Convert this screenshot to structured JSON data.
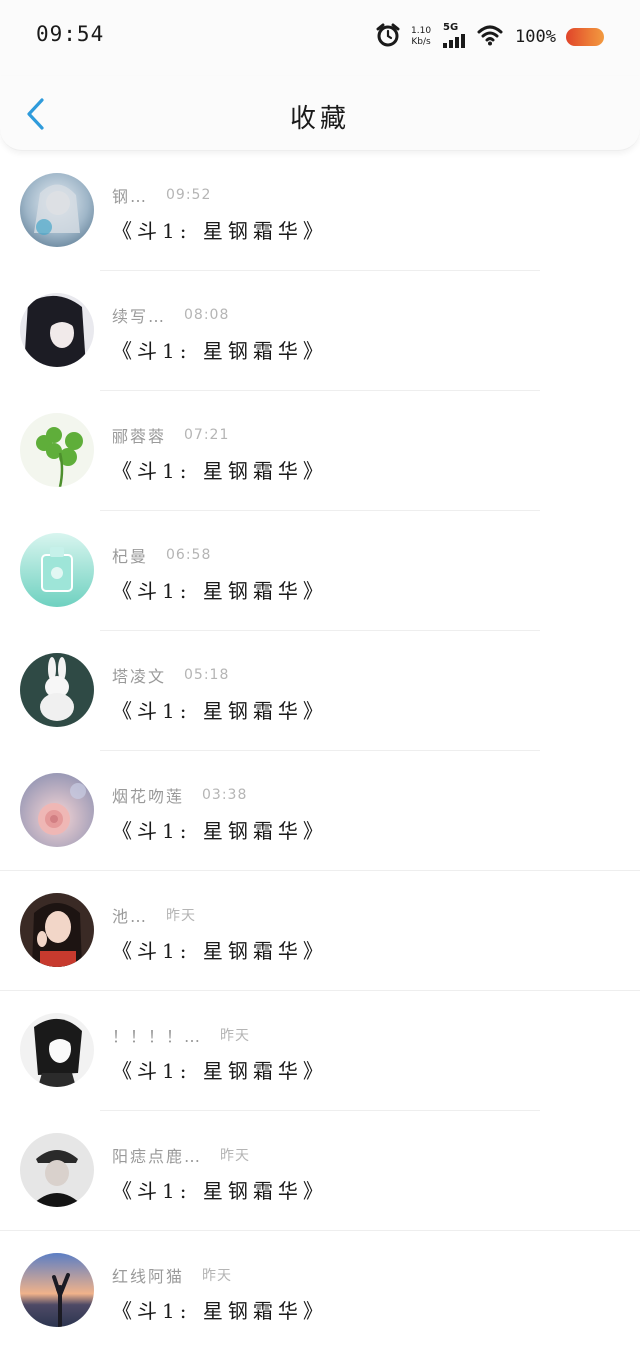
{
  "status": {
    "time": "09:54",
    "net_speed_value": "1.10",
    "net_speed_unit": "Kb/s",
    "network": "5G",
    "battery": "100%"
  },
  "nav": {
    "title": "收藏",
    "back_icon": "chevron-left-icon"
  },
  "colors": {
    "accent": "#2f9bdb",
    "battery": "#e8663a"
  },
  "items": [
    {
      "name": "钢…",
      "time": "09:52",
      "title": "《斗1: 星钢霜华》",
      "avatar": "avatar-anime-silver"
    },
    {
      "name": "续写…",
      "time": "08:08",
      "title": "《斗1: 星钢霜华》",
      "avatar": "avatar-anime-dark"
    },
    {
      "name": "郦蓉蓉",
      "time": "07:21",
      "title": "《斗1: 星钢霜华》",
      "avatar": "avatar-clover"
    },
    {
      "name": "杞曼",
      "time": "06:58",
      "title": "《斗1: 星钢霜华》",
      "avatar": "avatar-mint-bottle"
    },
    {
      "name": "塔凌文",
      "time": "05:18",
      "title": "《斗1: 星钢霜华》",
      "avatar": "avatar-rabbit"
    },
    {
      "name": "烟花吻莲",
      "time": "03:38",
      "title": "《斗1: 星钢霜华》",
      "avatar": "avatar-rose"
    },
    {
      "name": "池…",
      "time": "昨天",
      "title": "《斗1: 星钢霜华》",
      "avatar": "avatar-girl"
    },
    {
      "name": "！！！！…",
      "time": "昨天",
      "title": "《斗1: 星钢霜华》",
      "avatar": "avatar-anime-bw"
    },
    {
      "name": "阳痣点鹿…",
      "time": "昨天",
      "title": "《斗1: 星钢霜华》",
      "avatar": "avatar-boy-hat"
    },
    {
      "name": "红线阿猫",
      "time": "昨天",
      "title": "《斗1: 星钢霜华》",
      "avatar": "avatar-sunset"
    }
  ]
}
